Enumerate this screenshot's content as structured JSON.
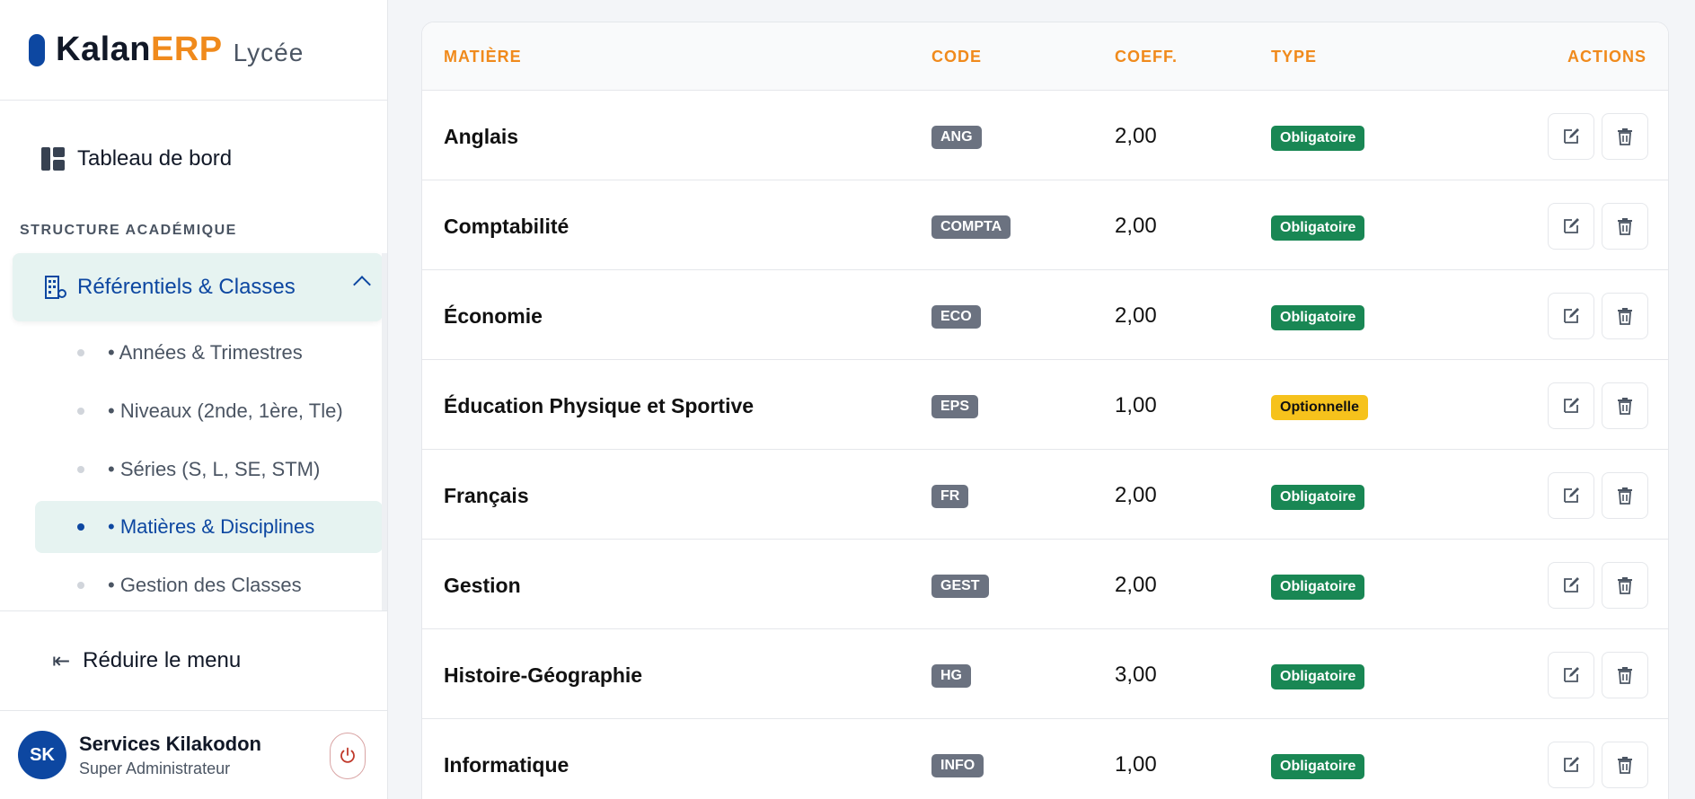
{
  "brand": {
    "name_part1": "Kalan",
    "name_part2": "ERP",
    "suffix": "Lycée"
  },
  "nav": {
    "dashboard": "Tableau de bord",
    "section_title": "STRUCTURE ACADÉMIQUE",
    "group_label": "Référentiels & Classes",
    "sub_items": [
      {
        "label": "• Années & Trimestres"
      },
      {
        "label": "• Niveaux (2nde, 1ère, Tle)"
      },
      {
        "label": "• Séries (S, L, SE, STM)"
      },
      {
        "label": "• Matières & Disciplines"
      },
      {
        "label": "• Gestion des Classes"
      }
    ],
    "collapse_label": "Réduire le menu"
  },
  "user": {
    "initials": "SK",
    "name": "Services Kilakodon",
    "role": "Super Administrateur"
  },
  "table": {
    "headers": {
      "matiere": "MATIÈRE",
      "code": "CODE",
      "coeff": "COEFF.",
      "type": "TYPE",
      "actions": "ACTIONS"
    },
    "rows": [
      {
        "name": "Anglais",
        "code": "ANG",
        "coeff": "2,00",
        "type": "Obligatoire"
      },
      {
        "name": "Comptabilité",
        "code": "COMPTA",
        "coeff": "2,00",
        "type": "Obligatoire"
      },
      {
        "name": "Économie",
        "code": "ECO",
        "coeff": "2,00",
        "type": "Obligatoire"
      },
      {
        "name": "Éducation Physique et Sportive",
        "code": "EPS",
        "coeff": "1,00",
        "type": "Optionnelle"
      },
      {
        "name": "Français",
        "code": "FR",
        "coeff": "2,00",
        "type": "Obligatoire"
      },
      {
        "name": "Gestion",
        "code": "GEST",
        "coeff": "2,00",
        "type": "Obligatoire"
      },
      {
        "name": "Histoire-Géographie",
        "code": "HG",
        "coeff": "3,00",
        "type": "Obligatoire"
      },
      {
        "name": "Informatique",
        "code": "INFO",
        "coeff": "1,00",
        "type": "Obligatoire"
      }
    ]
  },
  "colors": {
    "primary": "#0d47a1",
    "accent": "#f08a1c",
    "success": "#198754",
    "warning": "#f6c21c",
    "code_badge": "#6b7280"
  },
  "icons": {
    "dashboard": "grid-icon",
    "group": "building-icon",
    "collapse": "arrow-left-icon",
    "logout": "power-icon",
    "edit": "edit-icon",
    "delete": "trash-icon"
  }
}
